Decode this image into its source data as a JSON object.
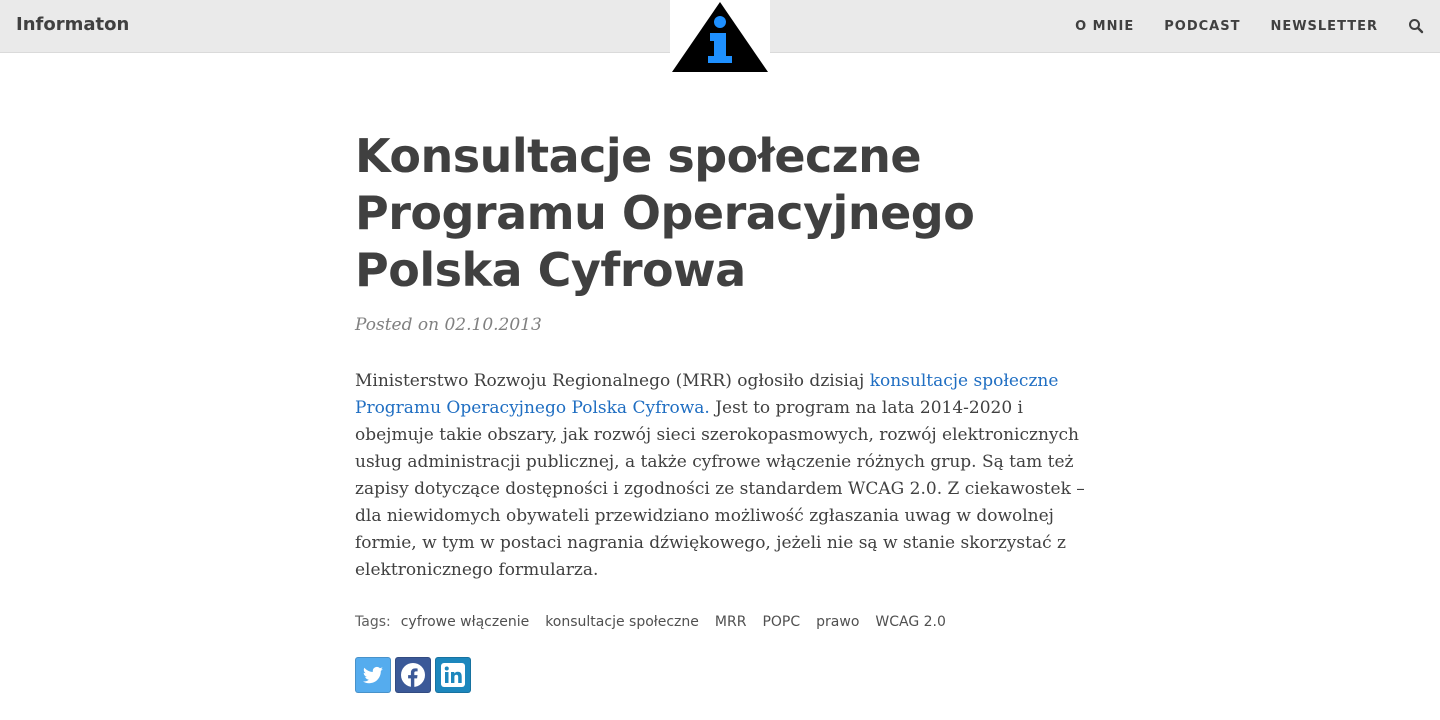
{
  "header": {
    "brand": "Informaton",
    "logo_icon": "info-triangle-logo",
    "nav": [
      {
        "label": "O MNIE"
      },
      {
        "label": "PODCAST"
      },
      {
        "label": "NEWSLETTER"
      }
    ],
    "search_icon": "search-icon"
  },
  "article": {
    "title": "Konsultacje społeczne Programu Operacyjnego Polska Cyfrowa",
    "posted": "Posted on 02.10.2013",
    "body_before": "Ministerstwo Rozwoju Regionalnego (MRR) ogłosiło dzisiaj ",
    "body_link": "konsultacje społeczne Programu Operacyjnego Polska Cyfrowa.",
    "body_after": " Jest to program na lata 2014-2020 i obejmuje takie obszary, jak rozwój sieci szerokopasmowych, rozwój elektronicznych usług administracji publicznej, a także cyfrowe włączenie różnych grup. Są tam też zapisy dotyczące dostępności i zgodności ze standardem WCAG 2.0. Z ciekawostek – dla niewidomych obywateli przewidziano możliwość zgłaszania uwag w dowolnej formie, w tym w postaci nagrania dźwiękowego, jeżeli nie są w stanie skorzystać z elektronicznego formularza.",
    "tags_label": "Tags:",
    "tags": [
      "cyfrowe włączenie",
      "konsultacje społeczne",
      "MRR",
      "POPC",
      "prawo",
      "WCAG 2.0"
    ],
    "share": [
      {
        "icon": "twitter-icon",
        "color": "#55acee"
      },
      {
        "icon": "facebook-icon",
        "color": "#3b5998"
      },
      {
        "icon": "linkedin-icon",
        "color": "#1c87bd"
      }
    ]
  },
  "colors": {
    "header_bg": "#eaeaea",
    "text": "#404040",
    "link": "#1f6ec2",
    "logo_blue": "#1e90ff"
  }
}
